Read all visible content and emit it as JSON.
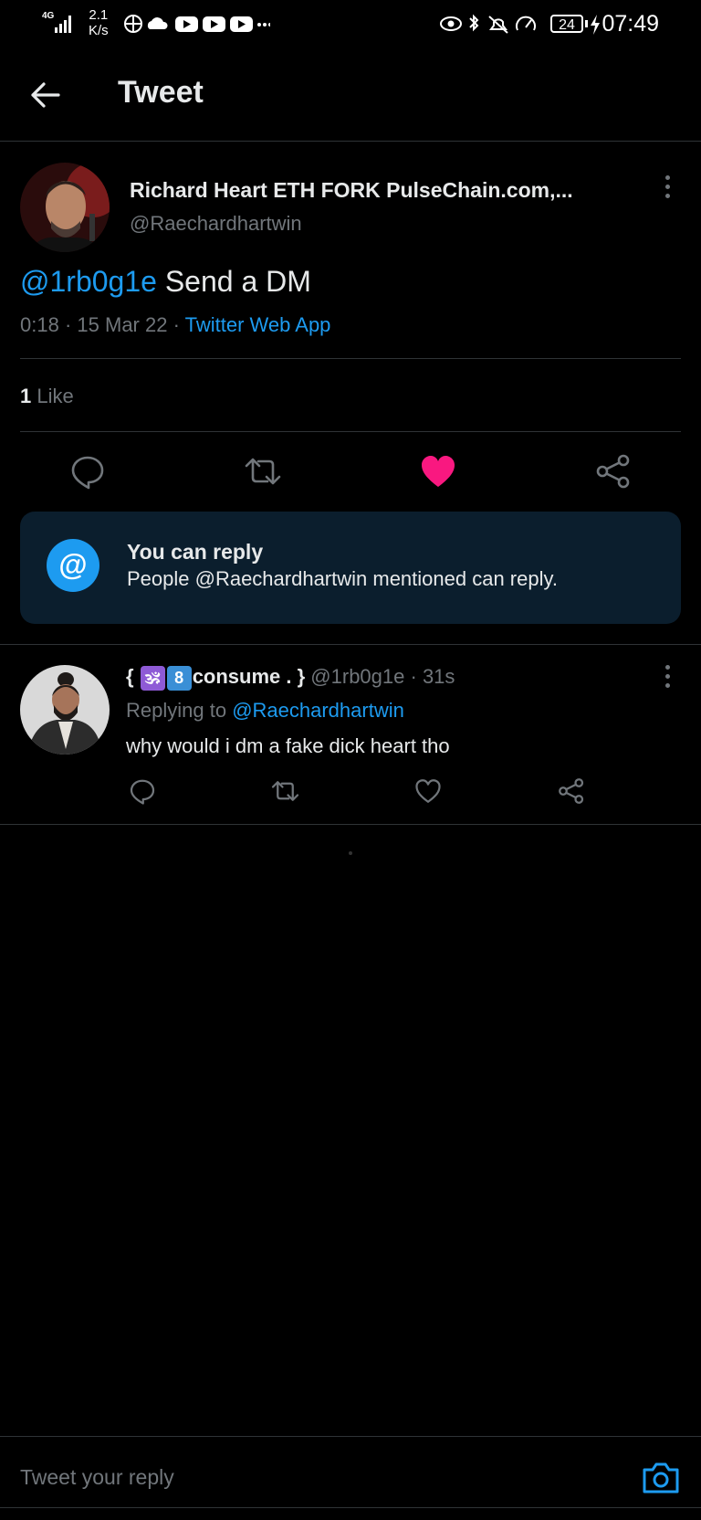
{
  "status_bar": {
    "network": "4G",
    "speed_value": "2.1",
    "speed_unit": "K/s",
    "battery": "24",
    "time": "07:49"
  },
  "header": {
    "title": "Tweet"
  },
  "tweet": {
    "author_name": "Richard Heart ETH FORK PulseChain.com,...",
    "author_handle": "@Raechardhartwin",
    "mention": "@1rb0g1e",
    "text": " Send a DM",
    "time": "0:18",
    "date": "15 Mar 22",
    "source": "Twitter Web App",
    "like_count": "1",
    "like_label": " Like",
    "liked": true,
    "like_color": "#f91880"
  },
  "reply_notice": {
    "title": "You can reply",
    "subtitle": "People @Raechardhartwin mentioned can reply."
  },
  "reply": {
    "name_open": "{ ",
    "emoji1": "🕉",
    "emoji2": "8",
    "name_main": "consume . }",
    "handle": "@1rb0g1e",
    "time": "· 31s",
    "replying_to_label": "Replying to ",
    "replying_to_handle": "@Raechardhartwin",
    "text": "why would i dm a fake dick heart tho"
  },
  "composer": {
    "placeholder": "Tweet your reply"
  },
  "colors": {
    "accent": "#1d9bf0",
    "background": "#000000",
    "notice_bg": "#0b1e2d"
  }
}
